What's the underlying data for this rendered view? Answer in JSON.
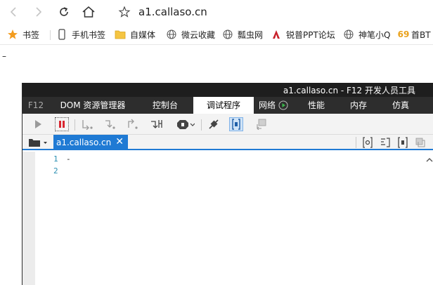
{
  "browser": {
    "url": "a1.callaso.cn",
    "nav_icons": [
      "back-icon",
      "forward-icon",
      "refresh-icon",
      "home-icon",
      "star-icon"
    ]
  },
  "bookmarks": [
    {
      "label": "书签",
      "icon": "star-icon"
    },
    {
      "label": "手机书签",
      "icon": "phone-icon"
    },
    {
      "label": "自媒体",
      "icon": "folder-icon"
    },
    {
      "label": "微云收藏",
      "icon": "globe-icon"
    },
    {
      "label": "瓢虫网",
      "icon": "globe-icon"
    },
    {
      "label": "锐普PPT论坛",
      "icon": "ppt-logo-icon"
    },
    {
      "label": "神笔小Q",
      "icon": "globe-icon"
    },
    {
      "label": "首BT",
      "icon": "69-logo-icon"
    }
  ],
  "page": {
    "dash": "–"
  },
  "devtools": {
    "title": "a1.callaso.cn - F12 开发人员工具",
    "tabs": [
      {
        "label": "F12"
      },
      {
        "label": "DOM 资源管理器"
      },
      {
        "label": "控制台"
      },
      {
        "label": "调试程序"
      },
      {
        "label": "网络"
      },
      {
        "label": "性能"
      },
      {
        "label": "内存"
      },
      {
        "label": "仿真"
      }
    ],
    "active_tab": "调试程序",
    "file_tab": "a1.callaso.cn",
    "file_tab_close": "✕",
    "lines": [
      {
        "num": "1",
        "text": "-"
      },
      {
        "num": "2",
        "text": ""
      }
    ]
  },
  "colors": {
    "accent": "#1f7ad4",
    "titlebar": "#1e1e1e",
    "tabbar": "#2d2d2d",
    "pause_red": "#d9262f",
    "line_number": "#2b8fb1"
  }
}
